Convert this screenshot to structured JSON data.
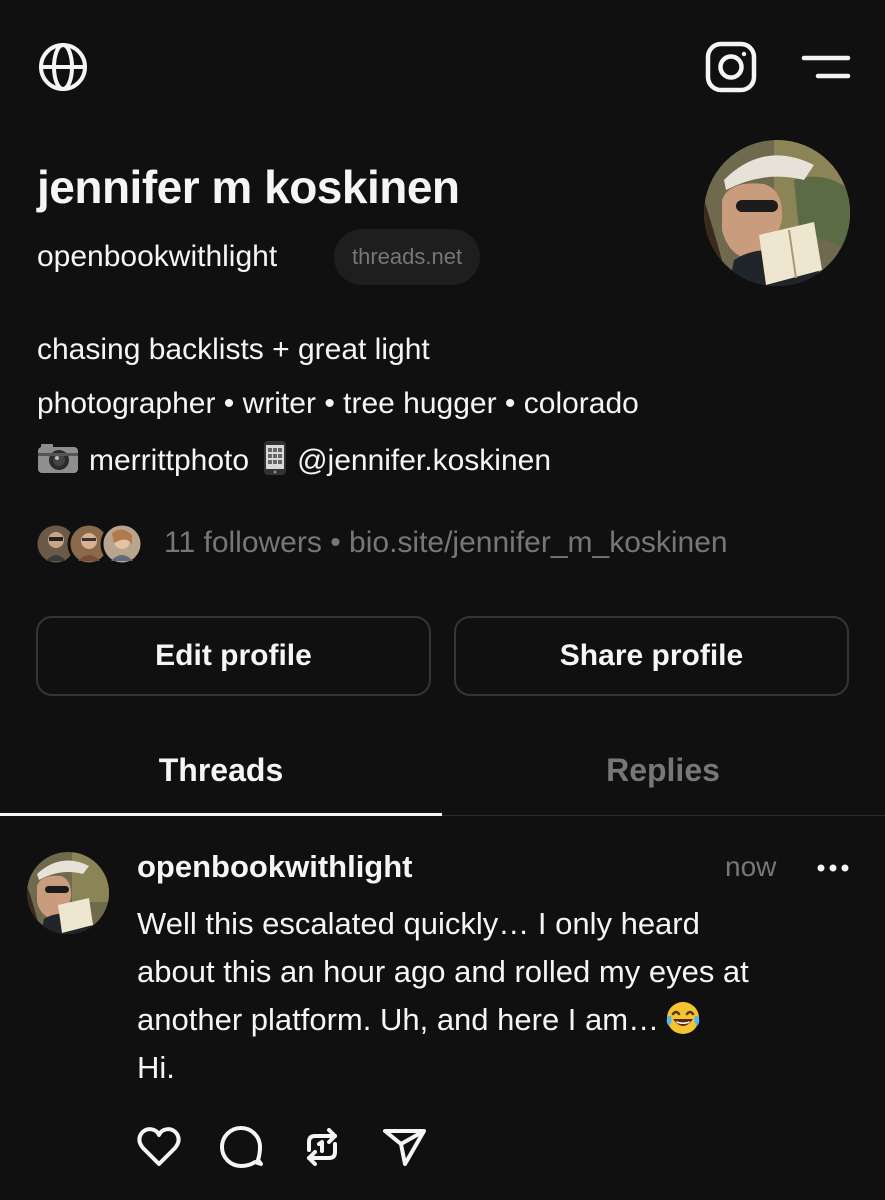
{
  "top_bar": {
    "left_icon": "globe-icon",
    "right_icons": [
      "instagram-icon",
      "menu-icon"
    ]
  },
  "profile": {
    "name": "jennifer m koskinen",
    "handle": "openbookwithlight",
    "domain_badge": "threads.net",
    "bio_line1": "chasing backlists + great light",
    "bio_line2": "photographer • writer • tree hugger • colorado",
    "bio_line3_part1": "merrittphoto",
    "bio_line3_part2": "@jennifer.koskinen",
    "followers_text": "11 followers",
    "separator": " • ",
    "link": "bio.site/jennifer_m_koskinen"
  },
  "buttons": {
    "edit_label": "Edit profile",
    "share_label": "Share profile"
  },
  "tabs": [
    {
      "label": "Threads",
      "active": true
    },
    {
      "label": "Replies",
      "active": false
    }
  ],
  "post": {
    "username": "openbookwithlight",
    "time": "now",
    "line1": "Well this escalated quickly… I only heard",
    "line2": "about this an hour ago and rolled my eyes at",
    "line3": "another platform. Uh, and here I am…",
    "line4": "Hi.",
    "actions": [
      "heart-icon",
      "comment-icon",
      "repost-icon",
      "send-icon"
    ]
  },
  "colors": {
    "background": "#101010",
    "text_primary": "#f3f5f7",
    "text_secondary": "#777777",
    "border": "#333638"
  }
}
